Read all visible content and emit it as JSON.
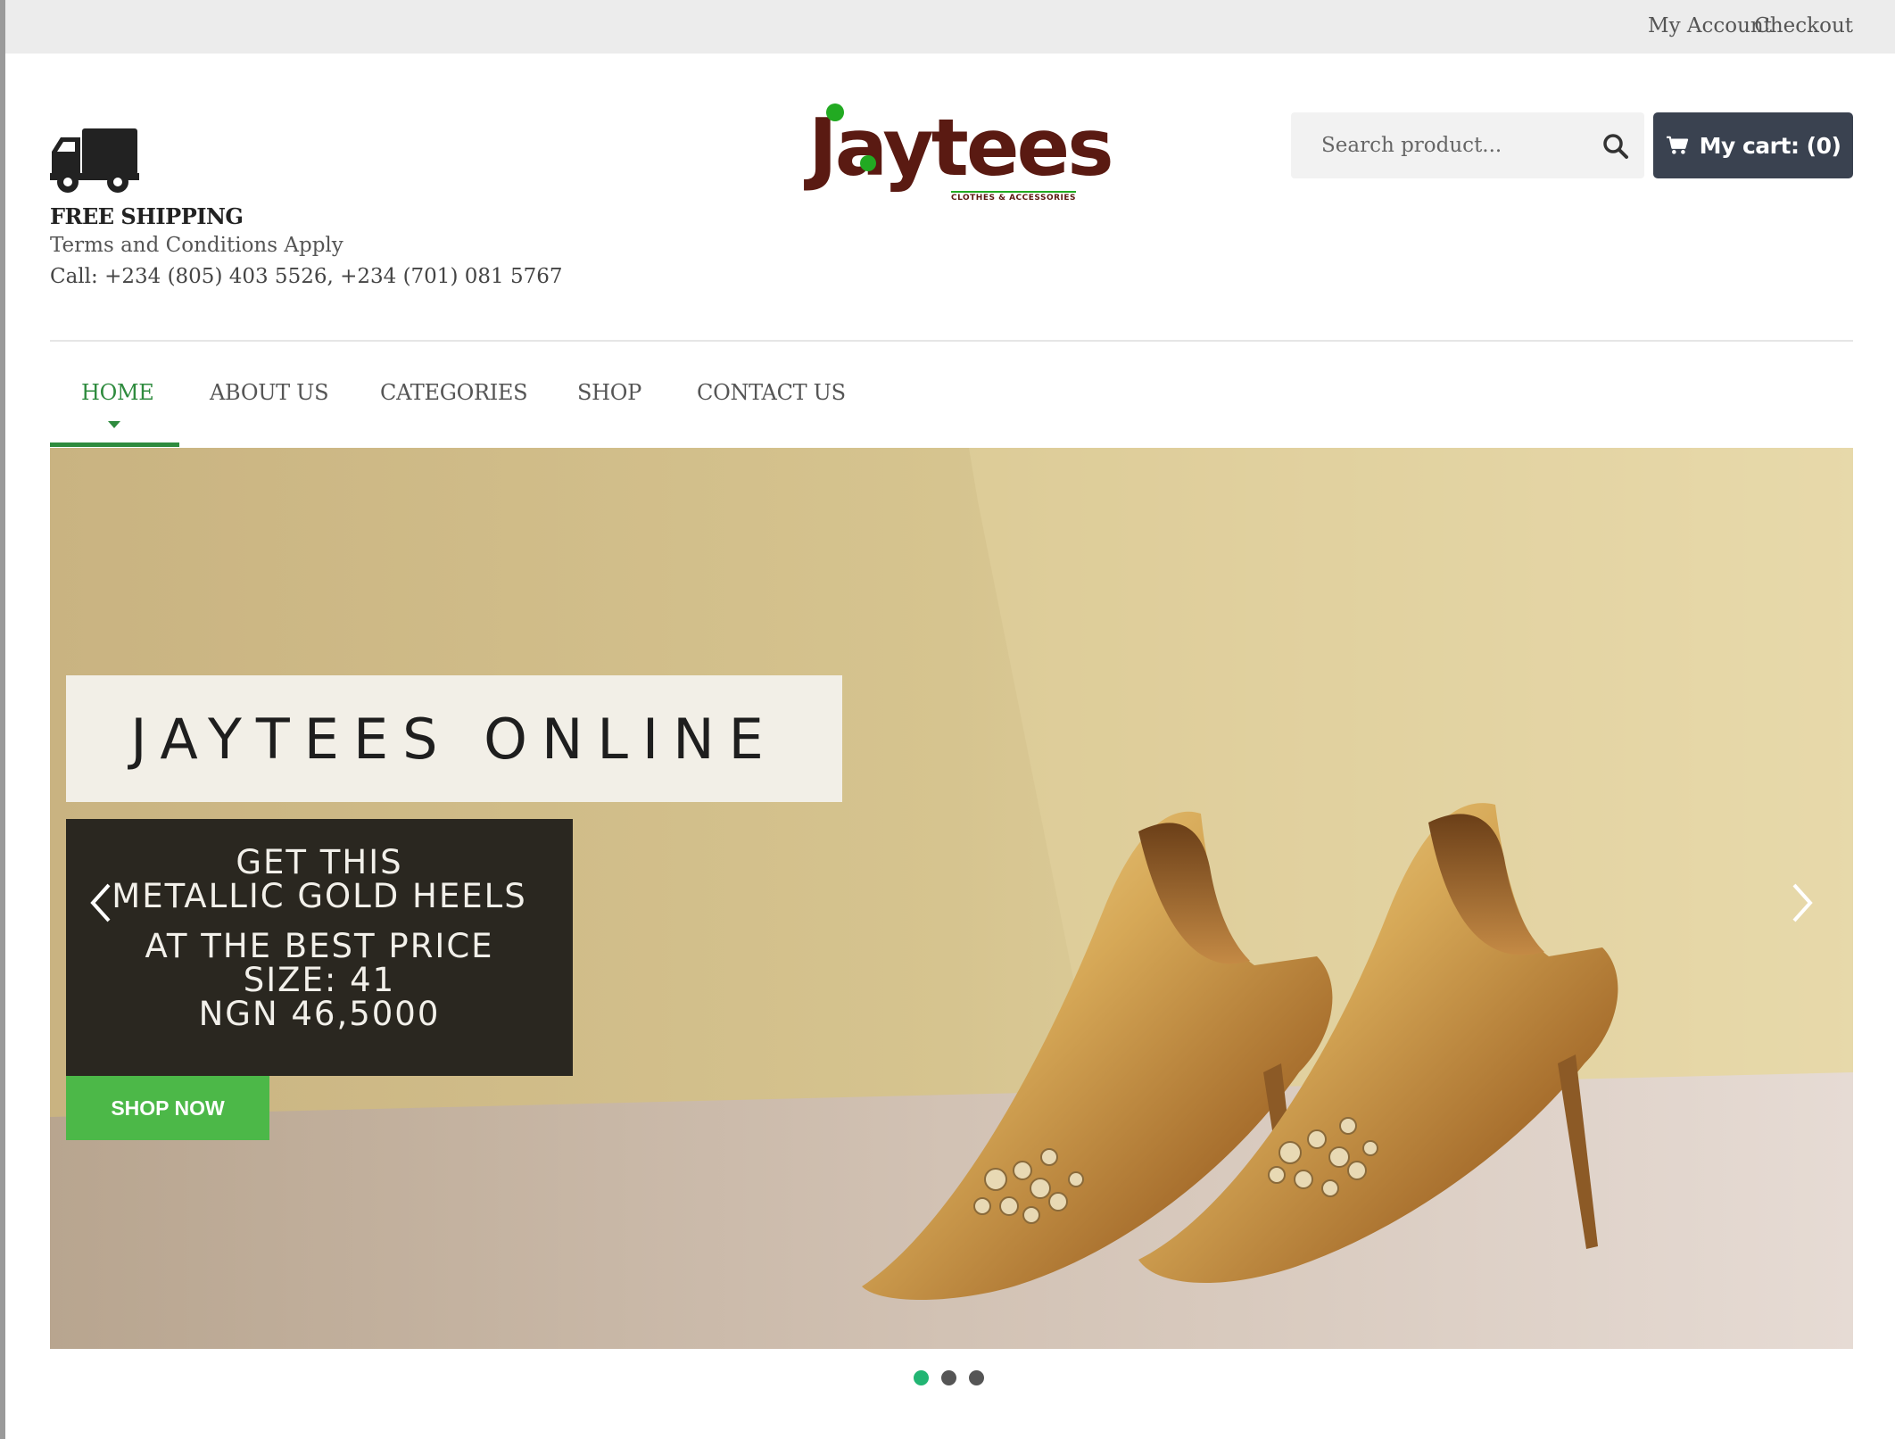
{
  "topbar": {
    "my_account": "My Account",
    "checkout": "Checkout"
  },
  "shipping": {
    "title": "FREE SHIPPING",
    "terms": "Terms and Conditions Apply",
    "call": "Call: +234 (805) 403 5526, +234 (701) 081 5767",
    "icon": "truck-icon"
  },
  "logo": {
    "name": "Jaytees",
    "tagline": "CLOTHES & ACCESSORIES"
  },
  "search": {
    "placeholder": "Search product...",
    "icon": "search-icon"
  },
  "cart": {
    "label": "My cart: (0)",
    "icon": "cart-icon"
  },
  "nav": {
    "items": [
      {
        "label": "HOME",
        "active": true
      },
      {
        "label": "ABOUT US",
        "active": false
      },
      {
        "label": "CATEGORIES",
        "active": false
      },
      {
        "label": "SHOP",
        "active": false
      },
      {
        "label": "CONTACT US",
        "active": false
      }
    ]
  },
  "slider": {
    "title": "JAYTEES ONLINE",
    "desc_line1": "GET THIS",
    "desc_line2": "METALLIC GOLD HEELS",
    "desc_line3": "AT THE BEST PRICE",
    "desc_line4": "SIZE: 41",
    "desc_line5": "NGN 46,5000",
    "cta": "SHOP NOW",
    "slides": 3,
    "active_slide": 1
  },
  "colors": {
    "accent_green": "#2e8b3e",
    "button_green": "#4cb848",
    "cart_bg": "#3a4250",
    "logo_brown": "#5a1a12",
    "dot_active": "#22b573"
  }
}
